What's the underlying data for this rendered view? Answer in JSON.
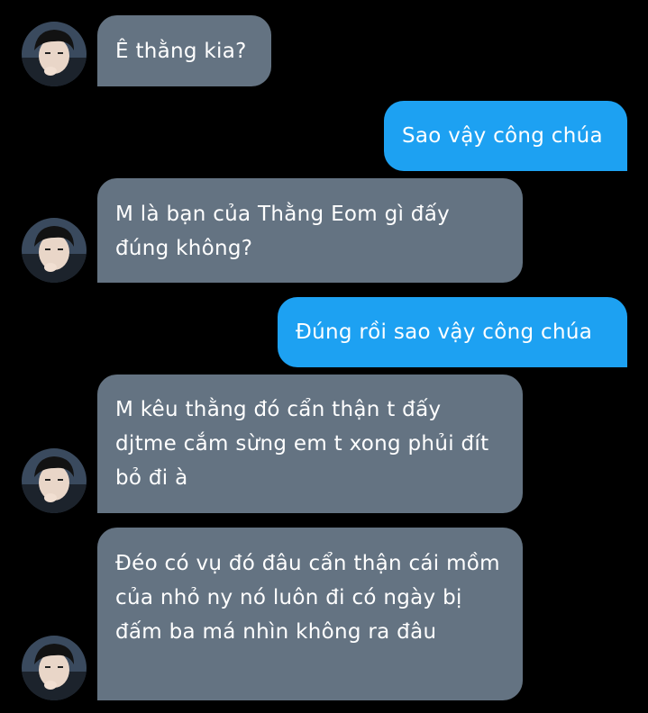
{
  "chat": {
    "messages": [
      {
        "side": "incoming",
        "text": "Ê thằng kia?"
      },
      {
        "side": "outgoing",
        "text": "Sao vậy công chúa"
      },
      {
        "side": "incoming",
        "text": "M là bạn của Thằng Eom gì đấy đúng không?"
      },
      {
        "side": "outgoing",
        "text": "Đúng rồi sao vậy công chúa"
      },
      {
        "side": "incoming",
        "text": "M kêu thằng đó cẩn thận t đấy djtme cắm sừng em t xong phủi đít bỏ đi à"
      },
      {
        "side": "incoming",
        "text": "Đéo có vụ đó đâu cẩn thận cái mồm của nhỏ ny nó luôn đi có ngày bị đấm ba má nhìn không ra đâu"
      }
    ]
  },
  "colors": {
    "background": "#000000",
    "incoming_bubble": "#647382",
    "outgoing_bubble": "#1da1f2",
    "text": "#ffffff"
  },
  "icons": {
    "avatar": "contact-avatar-icon"
  }
}
